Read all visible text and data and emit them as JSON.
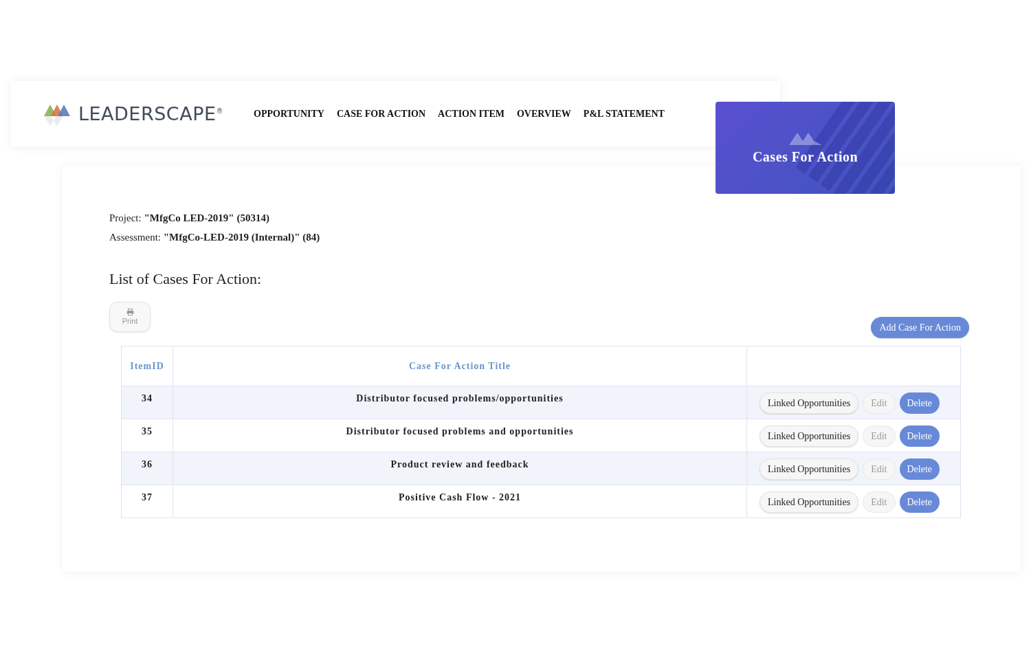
{
  "header": {
    "logo_text": "LEADERSCAPE",
    "logo_mark": "®",
    "nav": [
      {
        "label": "OPPORTUNITY"
      },
      {
        "label": "CASE FOR ACTION"
      },
      {
        "label": "ACTION ITEM"
      },
      {
        "label": "OVERVIEW"
      },
      {
        "label": "P&L STATEMENT"
      }
    ]
  },
  "banner": {
    "title": "Cases For Action"
  },
  "info": [
    "Project: **\"MfgCo LED-2019\" (50314)**",
    "Assessment: **\"MfgCo-LED-2019 (Internal)\" (84)**"
  ],
  "list_title": "List of Cases For Action:",
  "print_button": "Print",
  "add_button": "Add Case For Action",
  "table": {
    "columns": [
      "ItemID",
      "Case For Action Title"
    ],
    "rows": [
      {
        "id": "34",
        "title": "Distributor focused problems/opportunities",
        "actions": [
          "Linked Opportunities",
          "Edit",
          "Delete"
        ]
      },
      {
        "id": "35",
        "title": "Distributor focused problems and opportunities",
        "actions": [
          "Linked Opportunities",
          "Edit",
          "Delete"
        ]
      },
      {
        "id": "36",
        "title": "Product review and feedback",
        "actions": [
          "Linked Opportunities",
          "Edit",
          "Delete"
        ]
      },
      {
        "id": "37",
        "title": "Positive Cash Flow - 2021",
        "actions": [
          "Linked Opportunities",
          "Edit",
          "Delete"
        ]
      }
    ]
  }
}
